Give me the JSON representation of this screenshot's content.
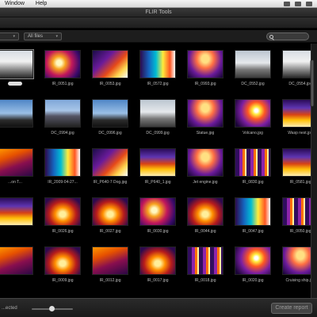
{
  "menubar": {
    "items": [
      "Window",
      "Help"
    ]
  },
  "window": {
    "title": "FLIR Tools"
  },
  "filter": {
    "folder_value": "",
    "files_value": "All files",
    "search_placeholder": ""
  },
  "thumbnails": [
    [
      {
        "caption": "",
        "palette": "p4",
        "selected": true
      },
      {
        "caption": "IR_0051.jpg",
        "palette": "t1"
      },
      {
        "caption": "IR_0053.jpg",
        "palette": "t2"
      },
      {
        "caption": "IR_0572.jpg",
        "palette": "t8"
      },
      {
        "caption": "IR_0993.jpg",
        "palette": "t9"
      },
      {
        "caption": "DC_0552.jpg",
        "palette": "p2"
      },
      {
        "caption": "DC_0554.jpg",
        "palette": "p4"
      }
    ],
    [
      {
        "caption": "",
        "palette": "p3"
      },
      {
        "caption": "DC_0994.jpg",
        "palette": "p1"
      },
      {
        "caption": "DC_0996.jpg",
        "palette": "p3"
      },
      {
        "caption": "DC_0999.jpg",
        "palette": "p2"
      },
      {
        "caption": "Statue.jpg",
        "palette": "t9"
      },
      {
        "caption": "Volcano.jpg",
        "palette": "t6"
      },
      {
        "caption": "Wasp nest.jpg",
        "palette": "t4"
      }
    ],
    [
      {
        "caption": "...on T...",
        "palette": "t7"
      },
      {
        "caption": "IR_2009-04-27...",
        "palette": "t8"
      },
      {
        "caption": "IR_P640-7 Dog.jpg",
        "palette": "t2"
      },
      {
        "caption": "IR_P640_1.jpg",
        "palette": "t4"
      },
      {
        "caption": "Jet engine.jpg",
        "palette": "t9"
      },
      {
        "caption": "IR_0830.jpg",
        "palette": "t5"
      },
      {
        "caption": "IR_0581.jpg",
        "palette": "t4"
      }
    ],
    [
      {
        "caption": "",
        "palette": "t4"
      },
      {
        "caption": "IR_0026.jpg",
        "palette": "t3"
      },
      {
        "caption": "IR_0027.jpg",
        "palette": "t3"
      },
      {
        "caption": "IR_0030.jpg",
        "palette": "t1"
      },
      {
        "caption": "IR_0044.jpg",
        "palette": "t3"
      },
      {
        "caption": "IR_0047.jpg",
        "palette": "t8"
      },
      {
        "caption": "IR_0050.jpg",
        "palette": "t5"
      }
    ],
    [
      {
        "caption": "",
        "palette": "t7"
      },
      {
        "caption": "IR_0009.jpg",
        "palette": "t3"
      },
      {
        "caption": "IR_0012.jpg",
        "palette": "t7"
      },
      {
        "caption": "IR_0017.jpg",
        "palette": "t3"
      },
      {
        "caption": "IR_0018.jpg",
        "palette": "t5"
      },
      {
        "caption": "IR_0020.jpg",
        "palette": "t6"
      },
      {
        "caption": "Cruising ship.jpg",
        "palette": "t9"
      }
    ]
  ],
  "status": {
    "selection_text": "...ected",
    "report_button": "Create report"
  }
}
